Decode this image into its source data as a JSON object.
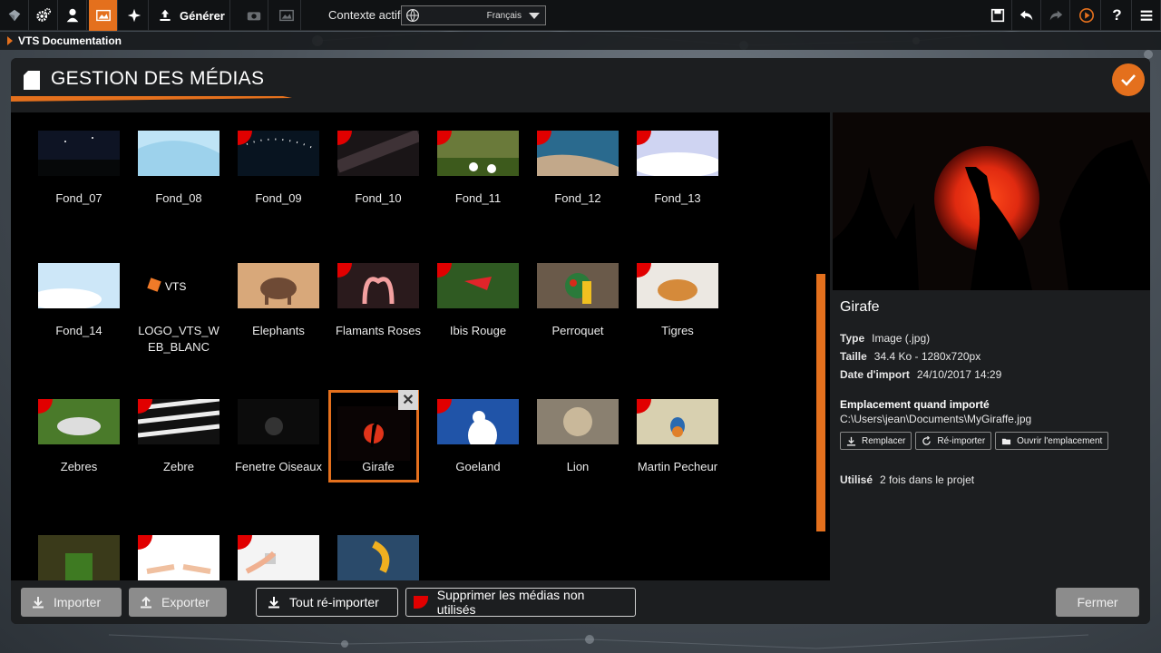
{
  "toolbar": {
    "generate_label": "Générer",
    "context_label": "Contexte actif",
    "language": "Français",
    "icons": [
      "logo-icon",
      "settings-icon",
      "users-icon",
      "media-icon",
      "effects-icon",
      "upload-icon",
      "camera-icon",
      "picture-icon",
      "save-icon",
      "undo-icon",
      "redo-icon",
      "play-icon",
      "help-icon",
      "menu-icon"
    ]
  },
  "breadcrumb": {
    "label": "VTS Documentation"
  },
  "dialog": {
    "title": "GESTION DES MÉDIAS",
    "accent_color": "#e4701d"
  },
  "media": [
    {
      "name": "Fond_07",
      "flag": false
    },
    {
      "name": "Fond_08",
      "flag": false
    },
    {
      "name": "Fond_09",
      "flag": true
    },
    {
      "name": "Fond_10",
      "flag": true
    },
    {
      "name": "Fond_11",
      "flag": true
    },
    {
      "name": "Fond_12",
      "flag": true
    },
    {
      "name": "Fond_13",
      "flag": true
    },
    {
      "name": "Fond_14",
      "flag": false
    },
    {
      "name": "LOGO_VTS_W EB_BLANC",
      "flag": false
    },
    {
      "name": "Elephants",
      "flag": false
    },
    {
      "name": "Flamants Roses",
      "flag": true
    },
    {
      "name": "Ibis Rouge",
      "flag": true
    },
    {
      "name": "Perroquet",
      "flag": false
    },
    {
      "name": "Tigres",
      "flag": true
    },
    {
      "name": "Zebres",
      "flag": true
    },
    {
      "name": "Zebre",
      "flag": true
    },
    {
      "name": "Fenetre Oiseaux",
      "flag": false
    },
    {
      "name": "Girafe",
      "flag": false,
      "selected": true
    },
    {
      "name": "Goeland",
      "flag": true
    },
    {
      "name": "Lion",
      "flag": false
    },
    {
      "name": "Martin Pecheur",
      "flag": true
    },
    {
      "name": "",
      "flag": false
    },
    {
      "name": "",
      "flag": true
    },
    {
      "name": "",
      "flag": true
    },
    {
      "name": "",
      "flag": false
    }
  ],
  "logo_text": "VTS",
  "detail": {
    "name": "Girafe",
    "type_label": "Type",
    "type_value": "Image (.jpg)",
    "size_label": "Taille",
    "size_value": "34.4 Ko - 1280x720px",
    "date_label": "Date d'import",
    "date_value": "24/10/2017 14:29",
    "location_label": "Emplacement quand importé",
    "location_value": "C:\\Users\\jean\\Documents\\MyGiraffe.jpg",
    "replace_label": "Remplacer",
    "reimport_label": "Ré-importer",
    "open_location_label": "Ouvrir l'emplacement",
    "used_label": "Utilisé",
    "used_value": "2 fois dans le projet"
  },
  "footer": {
    "import_label": "Importer",
    "export_label": "Exporter",
    "reimport_all_label": "Tout ré-importer",
    "delete_unused_label": "Supprimer les médias non utilisés",
    "close_label": "Fermer"
  }
}
